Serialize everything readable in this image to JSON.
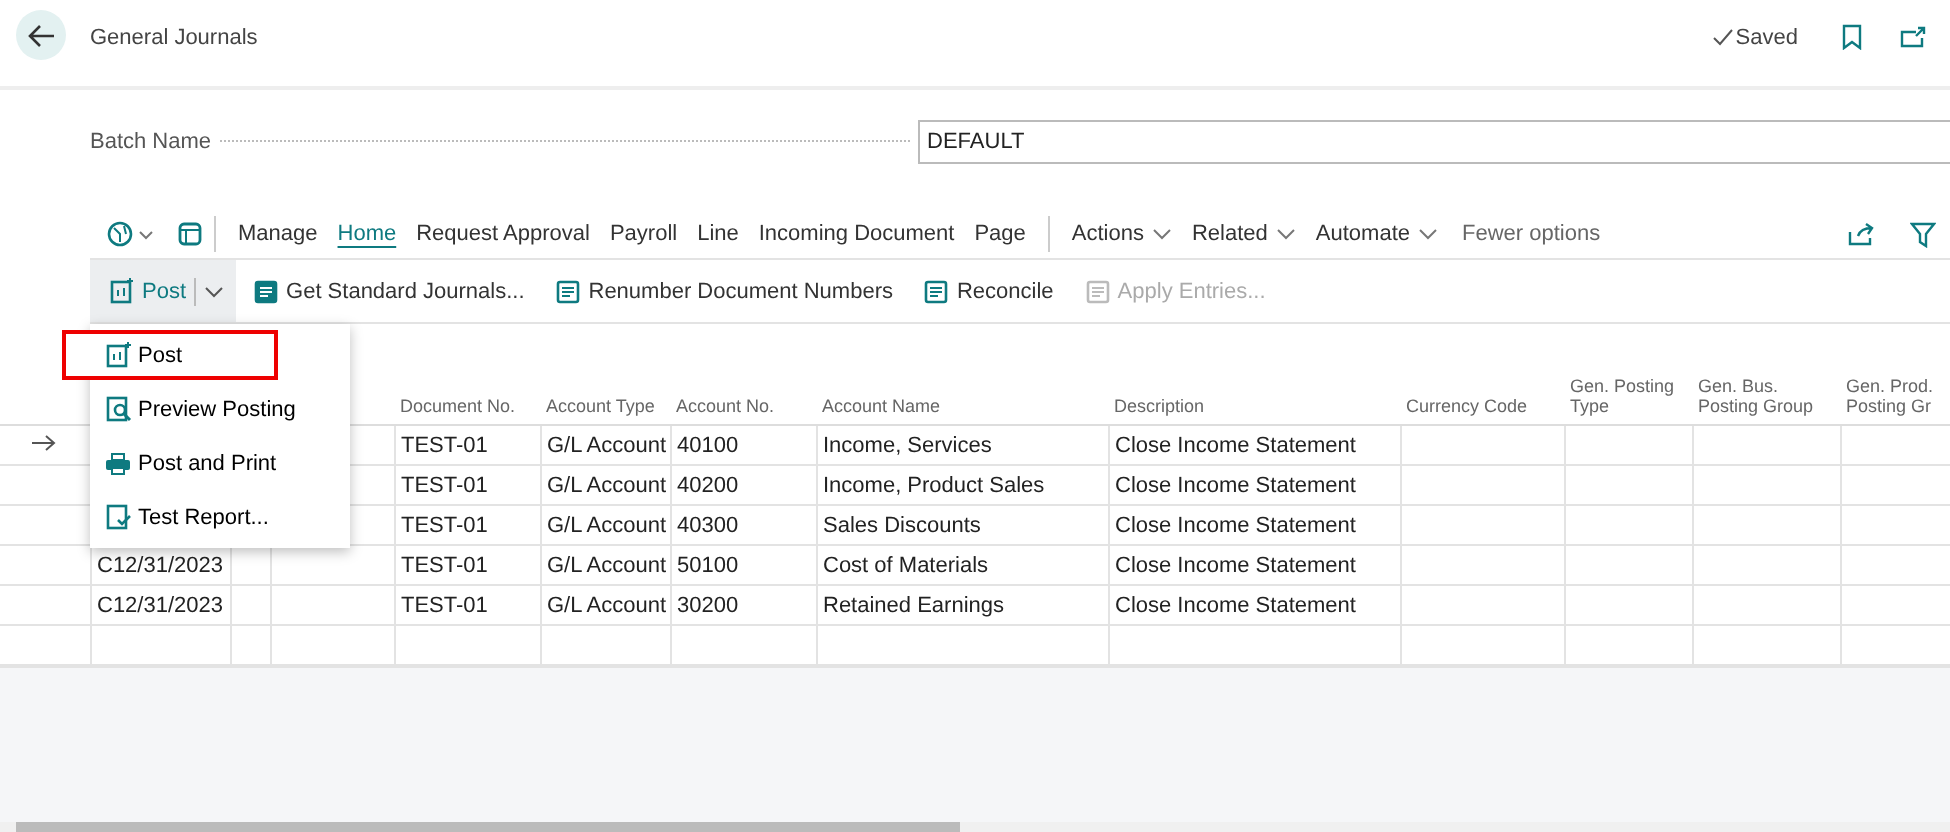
{
  "page": {
    "title": "General Journals",
    "status": "Saved"
  },
  "batch": {
    "label": "Batch Name",
    "value": "DEFAULT"
  },
  "action_tabs": [
    {
      "label": "Manage",
      "selected": false,
      "dropdown": false
    },
    {
      "label": "Home",
      "selected": true,
      "dropdown": false
    },
    {
      "label": "Request Approval",
      "selected": false,
      "dropdown": false
    },
    {
      "label": "Payroll",
      "selected": false,
      "dropdown": false
    },
    {
      "label": "Line",
      "selected": false,
      "dropdown": false
    },
    {
      "label": "Incoming Document",
      "selected": false,
      "dropdown": false
    },
    {
      "label": "Page",
      "selected": false,
      "dropdown": false
    },
    {
      "label": "Actions",
      "selected": false,
      "dropdown": true
    },
    {
      "label": "Related",
      "selected": false,
      "dropdown": true
    },
    {
      "label": "Automate",
      "selected": false,
      "dropdown": true
    }
  ],
  "fewer_options": "Fewer options",
  "home_actions": [
    {
      "label": "Post",
      "kind": "split",
      "disabled": false
    },
    {
      "label": "Get Standard Journals...",
      "kind": "journal",
      "disabled": false
    },
    {
      "label": "Renumber Document Numbers",
      "kind": "renumber",
      "disabled": false
    },
    {
      "label": "Reconcile",
      "kind": "reconcile",
      "disabled": false
    },
    {
      "label": "Apply Entries...",
      "kind": "apply",
      "disabled": true
    }
  ],
  "post_menu": [
    {
      "label": "Post",
      "kind": "post",
      "selected": true
    },
    {
      "label": "Preview Posting",
      "kind": "preview",
      "selected": false
    },
    {
      "label": "Post and Print",
      "kind": "print",
      "selected": false
    },
    {
      "label": "Test Report...",
      "kind": "report",
      "selected": false
    }
  ],
  "table": {
    "columns": [
      "",
      "",
      "",
      "Document No.",
      "Account Type",
      "Account No.",
      "Account Name",
      "Description",
      "Currency Code",
      "Gen. Posting Type",
      "Gen. Bus. Posting Group",
      "Gen. Prod. Posting Gr"
    ],
    "rows": [
      {
        "current": true,
        "cells": [
          "",
          "",
          "",
          "TEST-01",
          "G/L Account",
          "40100",
          "Income, Services",
          "Close Income Statement",
          "",
          "",
          "",
          ""
        ]
      },
      {
        "current": false,
        "cells": [
          "",
          "",
          "",
          "TEST-01",
          "G/L Account",
          "40200",
          "Income, Product Sales",
          "Close Income Statement",
          "",
          "",
          "",
          ""
        ]
      },
      {
        "current": false,
        "cells": [
          "",
          "",
          "",
          "TEST-01",
          "G/L Account",
          "40300",
          "Sales Discounts",
          "Close Income Statement",
          "",
          "",
          "",
          ""
        ]
      },
      {
        "current": false,
        "cells": [
          "C12/31/2023",
          "",
          "",
          "TEST-01",
          "G/L Account",
          "50100",
          "Cost of Materials",
          "Close Income Statement",
          "",
          "",
          "",
          ""
        ]
      },
      {
        "current": false,
        "cells": [
          "C12/31/2023",
          "",
          "",
          "TEST-01",
          "G/L Account",
          "30200",
          "Retained Earnings",
          "Close Income Statement",
          "",
          "",
          "",
          ""
        ]
      },
      {
        "current": false,
        "cells": [
          "",
          "",
          "",
          "",
          "",
          "",
          "",
          "",
          "",
          "",
          "",
          ""
        ]
      }
    ]
  }
}
